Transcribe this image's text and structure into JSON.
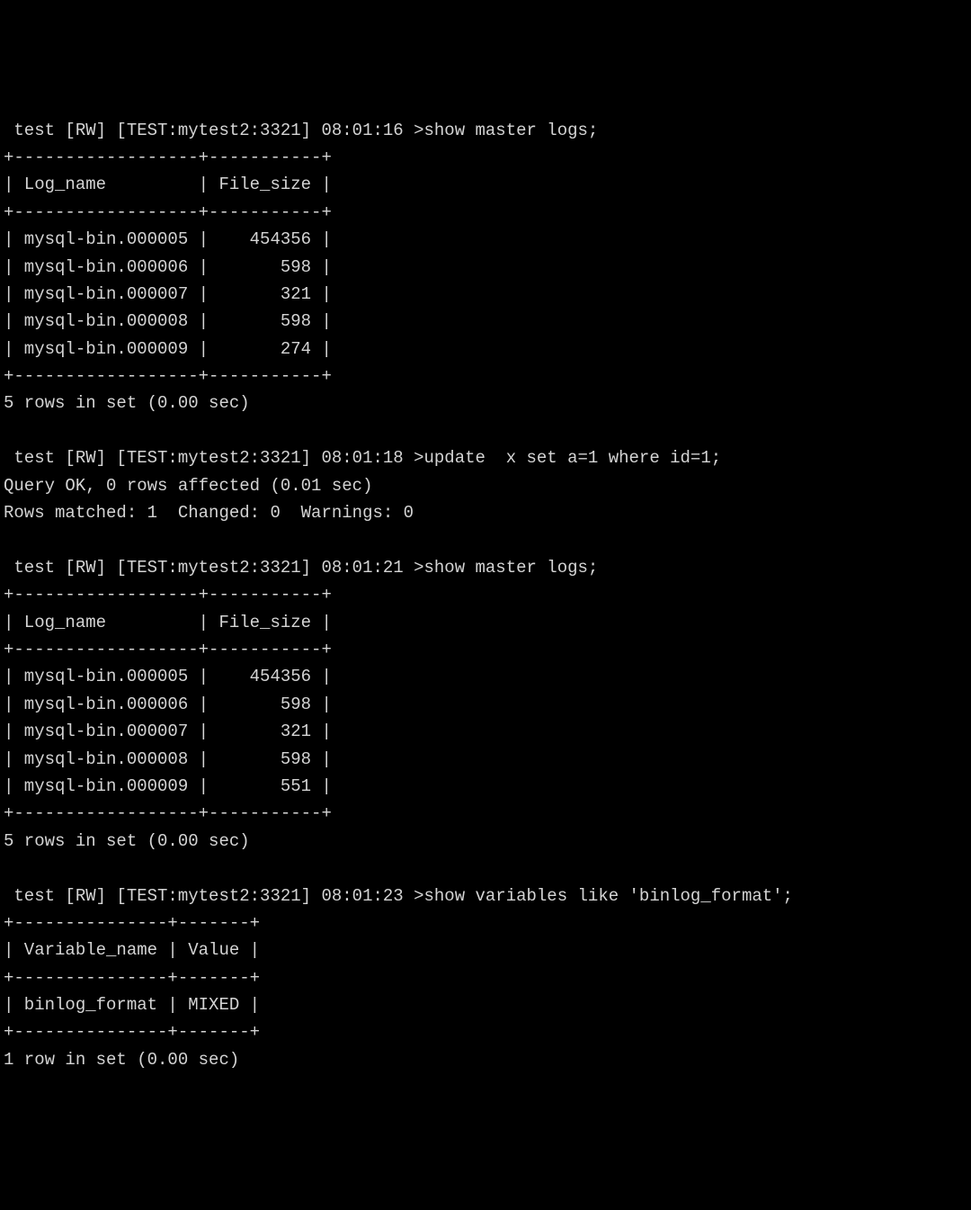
{
  "blocks": [
    {
      "prompt": " test [RW] [TEST:mytest2:3321] 08:01:16 >",
      "command": "show master logs;",
      "table": {
        "sep": "+------------------+-----------+",
        "header": "| Log_name         | File_size |",
        "rows": [
          "| mysql-bin.000005 |    454356 |",
          "| mysql-bin.000006 |       598 |",
          "| mysql-bin.000007 |       321 |",
          "| mysql-bin.000008 |       598 |",
          "| mysql-bin.000009 |       274 |"
        ]
      },
      "footer": "5 rows in set (0.00 sec)"
    },
    {
      "prompt": " test [RW] [TEST:mytest2:3321] 08:01:18 >",
      "command": "update  x set a=1 where id=1;",
      "result_lines": [
        "Query OK, 0 rows affected (0.01 sec)",
        "Rows matched: 1  Changed: 0  Warnings: 0"
      ]
    },
    {
      "prompt": " test [RW] [TEST:mytest2:3321] 08:01:21 >",
      "command": "show master logs;",
      "table": {
        "sep": "+------------------+-----------+",
        "header": "| Log_name         | File_size |",
        "rows": [
          "| mysql-bin.000005 |    454356 |",
          "| mysql-bin.000006 |       598 |",
          "| mysql-bin.000007 |       321 |",
          "| mysql-bin.000008 |       598 |",
          "| mysql-bin.000009 |       551 |"
        ]
      },
      "footer": "5 rows in set (0.00 sec)"
    },
    {
      "prompt": " test [RW] [TEST:mytest2:3321] 08:01:23 >",
      "command": "show variables like 'binlog_format';",
      "table": {
        "sep": "+---------------+-------+",
        "header": "| Variable_name | Value |",
        "rows": [
          "| binlog_format | MIXED |"
        ]
      },
      "footer": "1 row in set (0.00 sec)"
    }
  ]
}
